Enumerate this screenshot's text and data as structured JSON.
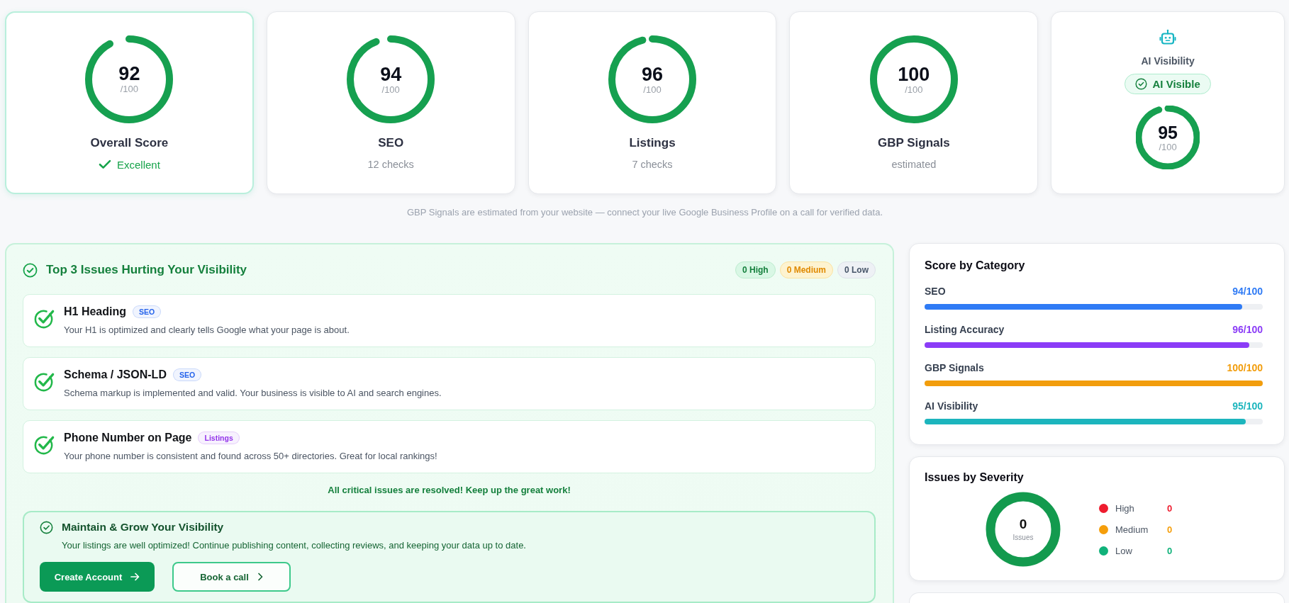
{
  "score_cards": [
    {
      "kind": "ring",
      "highlighted": true,
      "score": "92",
      "max": "/100",
      "level": 0.92,
      "label": "Overall Score",
      "status": "Excellent"
    },
    {
      "kind": "ring",
      "highlighted": false,
      "score": "94",
      "max": "/100",
      "level": 0.94,
      "label": "SEO",
      "subtitle": "12 checks"
    },
    {
      "kind": "ring",
      "highlighted": false,
      "score": "96",
      "max": "/100",
      "level": 0.96,
      "label": "Listings",
      "subtitle": "7 checks"
    },
    {
      "kind": "ring",
      "highlighted": false,
      "score": "100",
      "max": "/100",
      "level": 1,
      "label": "GBP Signals",
      "subtitle": "estimated"
    },
    {
      "kind": "ai",
      "highlighted": false,
      "label": "AI Visibility",
      "badge": "AI Visible",
      "score": "95",
      "max": "/100",
      "level": 0.95
    }
  ],
  "note": "GBP Signals are estimated from your website — connect your live Google Business Profile on a call for verified data.",
  "issues_panel": {
    "title": "Top 3 Issues Hurting Your Visibility",
    "severity_counts": [
      {
        "kind": "high",
        "label": "0 High"
      },
      {
        "kind": "medium",
        "label": "0 Medium"
      },
      {
        "kind": "low",
        "label": "0 Low"
      }
    ],
    "issues": [
      {
        "title": "H1 Heading",
        "tag": {
          "text": "SEO",
          "color": "#2563eb"
        },
        "description": "Your H1 is optimized and clearly tells Google what your page is about.",
        "resolved": true
      },
      {
        "title": "Schema / JSON-LD",
        "tag": {
          "text": "SEO",
          "color": "#2563eb"
        },
        "description": "Schema markup is implemented and valid. Your business is visible to AI and search engines.",
        "resolved": true
      },
      {
        "title": "Phone Number on Page",
        "tag": {
          "text": "Listings",
          "color": "#9333ea"
        },
        "description": "Your phone number is consistent and found across 50+ directories. Great for local rankings!",
        "resolved": true
      }
    ],
    "resolved_message": "All critical issues are resolved! Keep up the great work!",
    "next_steps": {
      "title": "Maintain & Grow Your Visibility",
      "text": "Your listings are well optimized! Continue publishing content, collecting reviews, and keeping your data up to date.",
      "buttons": [
        {
          "kind": "primary",
          "label": "Create Account"
        },
        {
          "kind": "secondary",
          "label": "Book a call"
        }
      ]
    }
  },
  "category_scores": {
    "title": "Score by Category",
    "rows": [
      {
        "label": "SEO",
        "value": "94/100",
        "level": 0.94,
        "color": "#2f7bf5"
      },
      {
        "label": "Listing Accuracy",
        "value": "96/100",
        "level": 0.96,
        "color": "#8b3cf7"
      },
      {
        "label": "GBP Signals",
        "value": "100/100",
        "level": 1,
        "color": "#f29d0c"
      },
      {
        "label": "AI Visibility",
        "value": "95/100",
        "level": 0.95,
        "color": "#1cb5bd"
      }
    ]
  },
  "issues_by_severity": {
    "title": "Issues by Severity",
    "total": "0",
    "total_label": "Issues",
    "legend": [
      {
        "label": "High",
        "value": "0",
        "color": "#ee1c2e"
      },
      {
        "label": "Medium",
        "value": "0",
        "color": "#f59e0b"
      },
      {
        "label": "Low",
        "value": "0",
        "color": "#10b27a"
      }
    ]
  }
}
